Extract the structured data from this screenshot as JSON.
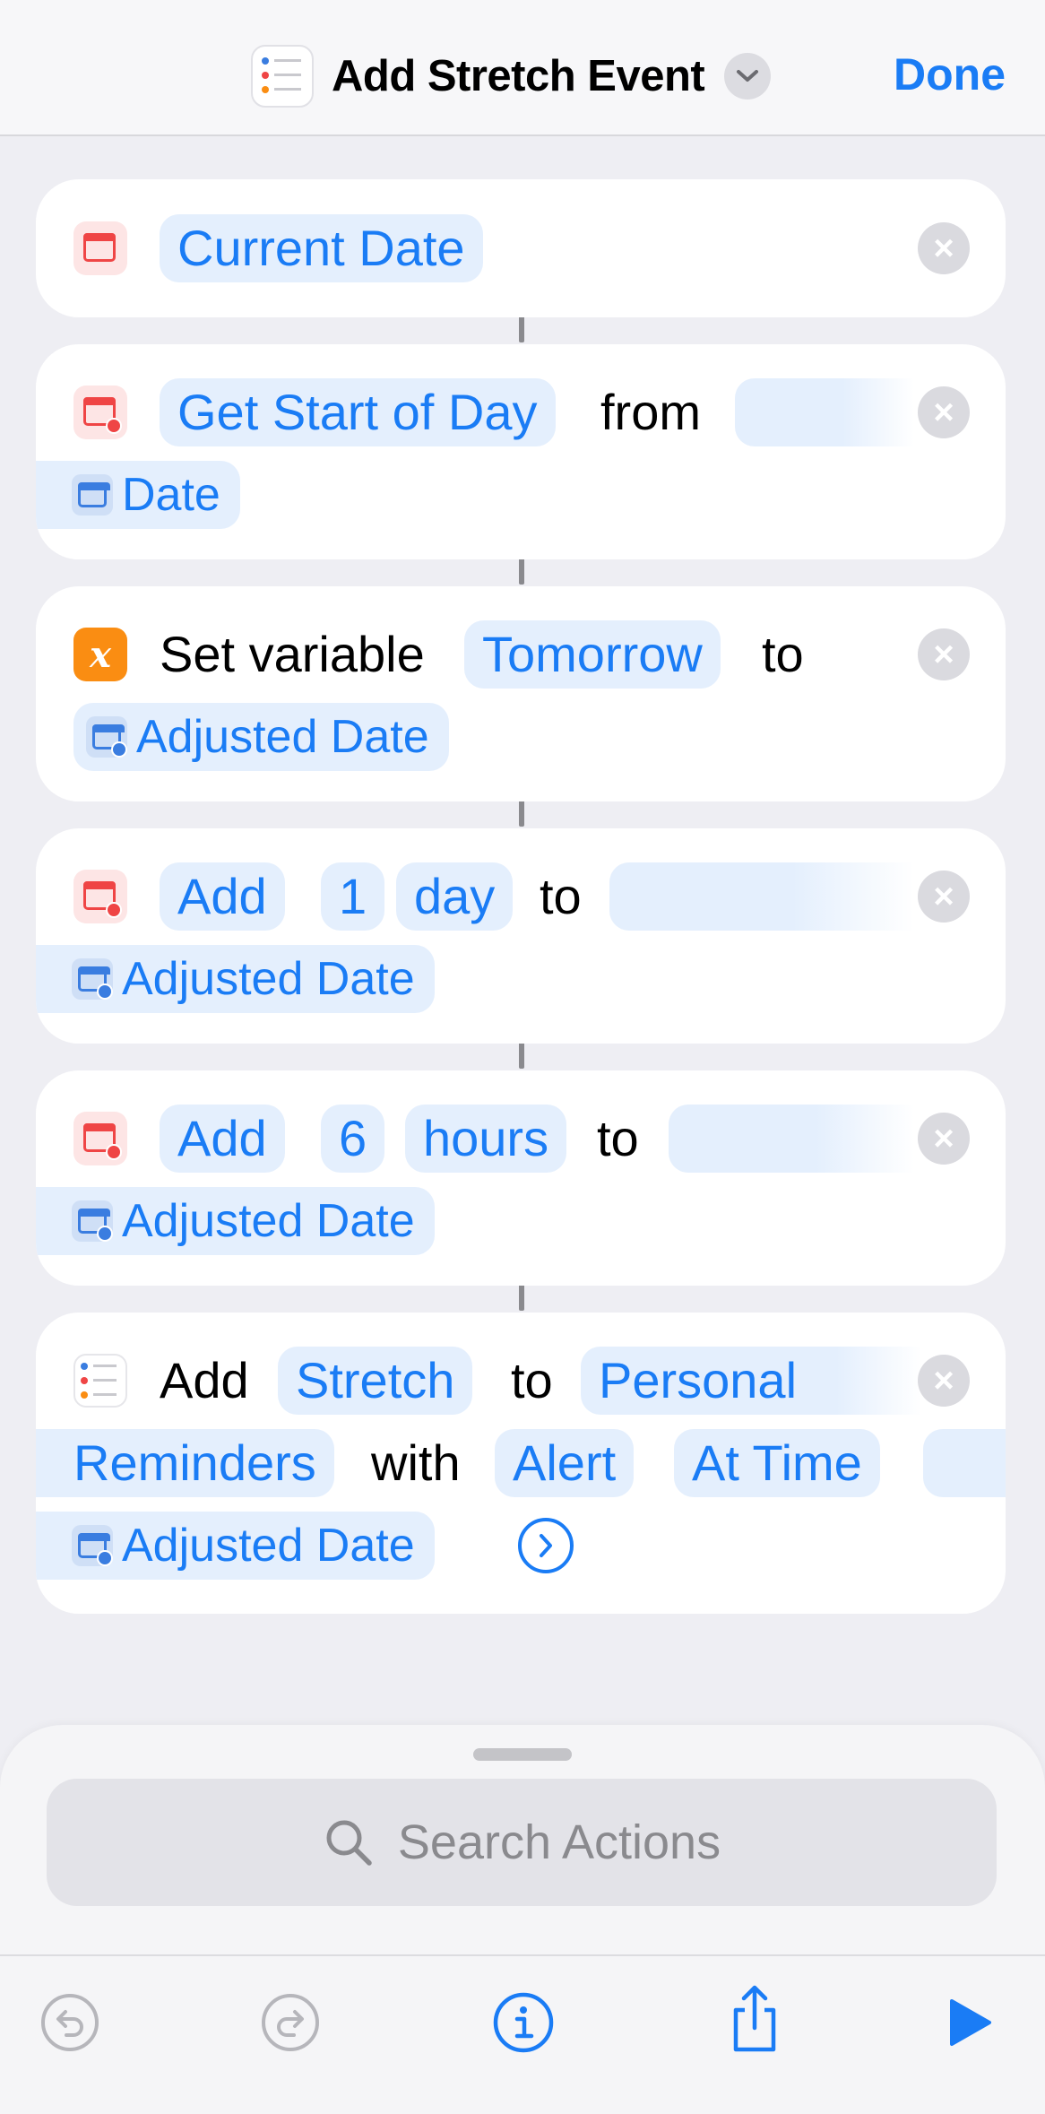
{
  "header": {
    "title": "Add Stretch Event",
    "done_label": "Done"
  },
  "colors": {
    "accent": "#1a7cf5",
    "token_bg": "#e4effd",
    "calendar_red": "#ef4545",
    "variable_orange": "#fa8d12"
  },
  "actions": [
    {
      "icon": "calendar-icon",
      "tokens": [
        "Current Date"
      ]
    },
    {
      "icon": "calendar-clock-icon",
      "tokens": [
        "Get Start of Day"
      ],
      "text": [
        "from"
      ],
      "variable": "Date"
    },
    {
      "icon": "variable-x-icon",
      "icon_glyph": "x",
      "text": [
        "Set variable",
        "to"
      ],
      "tokens": [
        "Tomorrow"
      ],
      "variable": "Adjusted Date"
    },
    {
      "icon": "calendar-clock-icon",
      "tokens": [
        "Add",
        "1",
        "day"
      ],
      "text": [
        "to"
      ],
      "variable": "Adjusted Date"
    },
    {
      "icon": "calendar-clock-icon",
      "tokens": [
        "Add",
        "6",
        "hours"
      ],
      "text": [
        "to"
      ],
      "variable": "Adjusted Date"
    },
    {
      "icon": "reminders-icon",
      "text": [
        "Add",
        "to",
        "with"
      ],
      "tokens": [
        "Stretch",
        "Personal",
        "Reminders",
        "Alert",
        "At Time"
      ],
      "variable": "Adjusted Date"
    }
  ],
  "search": {
    "placeholder": "Search Actions"
  },
  "toolbar": {
    "items": [
      "undo-icon",
      "redo-icon",
      "info-icon",
      "share-icon",
      "play-icon"
    ]
  }
}
